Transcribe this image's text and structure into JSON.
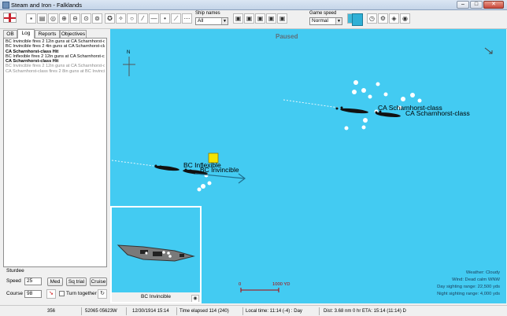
{
  "window": {
    "title": "Steam and Iron - Falklands",
    "min": "–",
    "max": "□",
    "close": "✕"
  },
  "toolbar": {
    "ship_names_label": "Ship names",
    "ship_names_value": "All",
    "game_speed_label": "Game speed",
    "game_speed_value": "Normal"
  },
  "tabs": [
    {
      "label": "OB",
      "active": false
    },
    {
      "label": "Log",
      "active": true
    },
    {
      "label": "Reports",
      "active": false
    },
    {
      "label": "Objectives",
      "active": false
    }
  ],
  "log": [
    {
      "text": "BC Invincible fires 2 12in guns at CA Scharnhorst-clas",
      "style": "normal"
    },
    {
      "text": "BC Invincible fires 2 4in guns at CA Scharnhorst-class",
      "style": "normal"
    },
    {
      "text": "CA Scharnhorst-class Hit",
      "style": "bold"
    },
    {
      "text": "BC Inflexible fires 2 12in guns at CA Scharnhorst-clas",
      "style": "normal"
    },
    {
      "text": "CA Scharnhorst-class Hit",
      "style": "bold"
    },
    {
      "text": "BC Invincible fires 2 12in guns at CA Scharnhorst-clas",
      "style": "grey"
    },
    {
      "text": "CA Scharnhorst-class fires 2 8in guns at BC Invincibl",
      "style": "grey"
    }
  ],
  "ship_control": {
    "unit": "Sturdee",
    "speed_label": "Speed",
    "speed_value": "25",
    "course_label": "Course",
    "course_value": "98",
    "med_label": "Med",
    "sq_trial_label": "Sq trial",
    "cruise_label": "Cruise",
    "turn_together_label": "Turn together"
  },
  "map": {
    "paused": "Paused",
    "north": "N",
    "ships": [
      {
        "label": "CA Scharnhorst-class"
      },
      {
        "label": "CA Scharnhorst-class"
      },
      {
        "label": "BC Inflexible"
      },
      {
        "label": "BC Invincible"
      }
    ],
    "scale_start": "0",
    "scale_end": "1000 YD",
    "inset_caption": "BC Invincible",
    "info": {
      "weather": "Weather: Cloudy",
      "wind": "Wind: Dead calm  WNW",
      "day_range": "Day sighting range: 22,500 yds",
      "night_range": "Night sighting range: 4,000 yds"
    },
    "colors": {
      "sea": "#43cbf2",
      "selected_marker": "#f5e400",
      "heading_arrow": "#1f6f8f"
    }
  },
  "status": {
    "id": "356",
    "position": "52065 05623W",
    "datetime": "12/30/1914 15:14",
    "time_elapsed": "Time elapsed 114 (240)",
    "local_time": "Local time: 11:14 (-4) : Day",
    "dist": "Dist: 3.68 nm 0 hr ETA: 15:14 (11:14) D"
  }
}
